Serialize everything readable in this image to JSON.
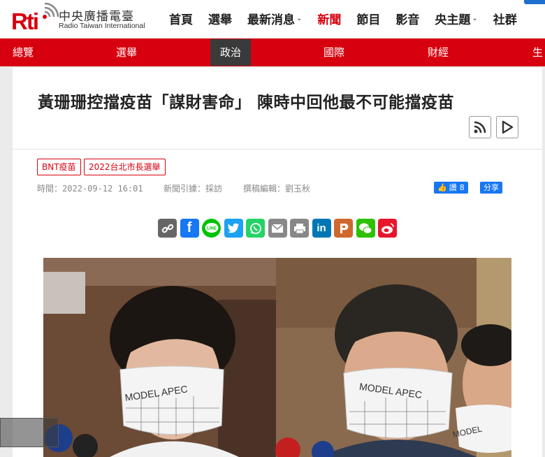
{
  "brand": {
    "logo_text": "Rti",
    "name_zh": "中央廣播電臺",
    "name_en": "Radio Taiwan International",
    "color": "#d7000f"
  },
  "top_nav": [
    {
      "label": "首頁",
      "dropdown": false,
      "active": false
    },
    {
      "label": "選舉",
      "dropdown": false,
      "active": false
    },
    {
      "label": "最新消息",
      "dropdown": true,
      "active": false
    },
    {
      "label": "新聞",
      "dropdown": false,
      "active": true
    },
    {
      "label": "節目",
      "dropdown": false,
      "active": false
    },
    {
      "label": "影音",
      "dropdown": false,
      "active": false
    },
    {
      "label": "央主題",
      "dropdown": true,
      "active": false
    },
    {
      "label": "社群",
      "dropdown": false,
      "active": false
    }
  ],
  "sub_nav": [
    {
      "label": "總覽",
      "active": false
    },
    {
      "label": "選舉",
      "active": false
    },
    {
      "label": "政治",
      "active": true
    },
    {
      "label": "國際",
      "active": false
    },
    {
      "label": "財經",
      "active": false
    },
    {
      "label": "生",
      "active": false
    }
  ],
  "article": {
    "title": "黃珊珊控擋疫苗「謀財害命」 陳時中回他最不可能擋疫苗",
    "tags": [
      "BNT疫苗",
      "2022台北市長選舉"
    ],
    "time": "時間：2022-09-12 16:01",
    "source": "新聞引據：採訪",
    "editor": "撰稿編輯：劉玉秋",
    "like_label": "讚",
    "like_count": "8",
    "share_label": "分享",
    "photo_mask_text_left": "MODEL APEC",
    "photo_mask_text_right": "MODEL APEC",
    "photo_mask_text_third": "MODEL"
  },
  "share_icons": [
    {
      "name": "copy-link-icon",
      "color": "#666666"
    },
    {
      "name": "facebook-icon",
      "color": "#1877f2"
    },
    {
      "name": "line-icon",
      "color": "#00c300"
    },
    {
      "name": "twitter-icon",
      "color": "#1da1f2"
    },
    {
      "name": "whatsapp-icon",
      "color": "#25d366"
    },
    {
      "name": "email-icon",
      "color": "#888888"
    },
    {
      "name": "print-icon",
      "color": "#888888"
    },
    {
      "name": "linkedin-icon",
      "color": "#0077b5"
    },
    {
      "name": "plurk-icon",
      "color": "#cf682f"
    },
    {
      "name": "wechat-icon",
      "color": "#2dc100"
    },
    {
      "name": "weibo-icon",
      "color": "#e6162d"
    }
  ]
}
